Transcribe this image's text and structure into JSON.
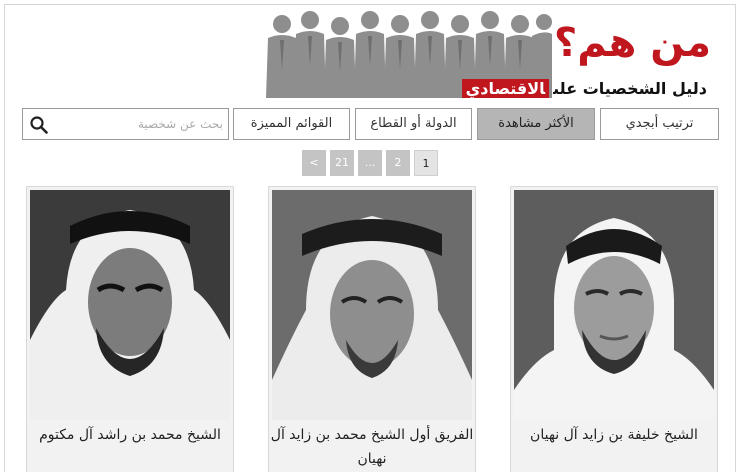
{
  "header": {
    "title": "من هم؟",
    "subtitle": "دليل الشخصيات على",
    "subtitle_highlight": "الاقتصادي"
  },
  "nav": {
    "alphabetical": "ترتيب أبجدي",
    "most_viewed": "الأكثر مشاهدة",
    "country_sector": "الدولة أو القطاع",
    "featured_lists": "القوائم المميزة",
    "search_placeholder": "بحث عن شخصية",
    "active": "most_viewed"
  },
  "pagination": {
    "current": "1",
    "page2": "2",
    "ellipsis": "...",
    "last": "21",
    "next": "<"
  },
  "people": [
    {
      "name": "الشيخ خليفة بن زايد آل نهيان"
    },
    {
      "name": "الفريق أول الشيخ محمد بن زايد آل نهيان"
    },
    {
      "name": "الشيخ محمد بن راشد آل مكتوم"
    }
  ],
  "colors": {
    "brand_red": "#c0161e",
    "active_tab": "#b5b5b5",
    "pager_bg": "#c4c4c4"
  },
  "icons": {
    "search": "search-icon"
  }
}
